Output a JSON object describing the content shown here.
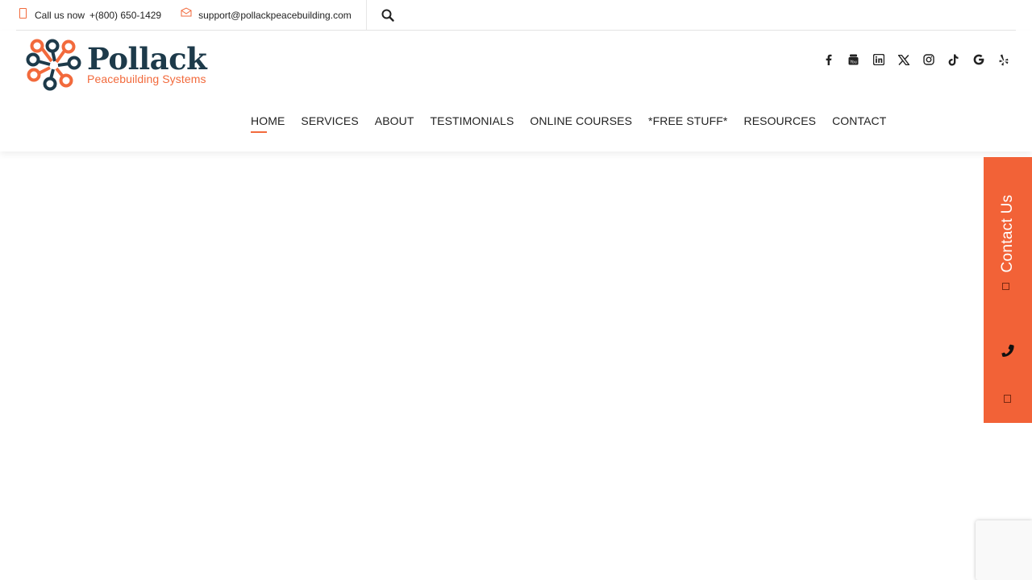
{
  "topbar": {
    "call_label": "Call us now",
    "phone": "+(800) 650-1429",
    "email": "support@pollackpeacebuilding.com"
  },
  "logo": {
    "title": "Pollack",
    "subtitle": "Peacebuilding Systems"
  },
  "socials": [
    "facebook-icon",
    "youtube-icon",
    "linkedin-icon",
    "x-icon",
    "instagram-icon",
    "tiktok-icon",
    "google-icon",
    "yelp-icon"
  ],
  "nav": {
    "items": [
      "HOME",
      "SERVICES",
      "ABOUT",
      "TESTIMONIALS",
      "ONLINE COURSES",
      "*FREE STUFF*",
      "RESOURCES",
      "CONTACT"
    ],
    "active": "HOME"
  },
  "side_panel": {
    "contact_label": "Contact Us"
  },
  "colors": {
    "accent": "#f26a3c",
    "panel": "#f26237",
    "brand_dark": "#1d3a4a"
  }
}
